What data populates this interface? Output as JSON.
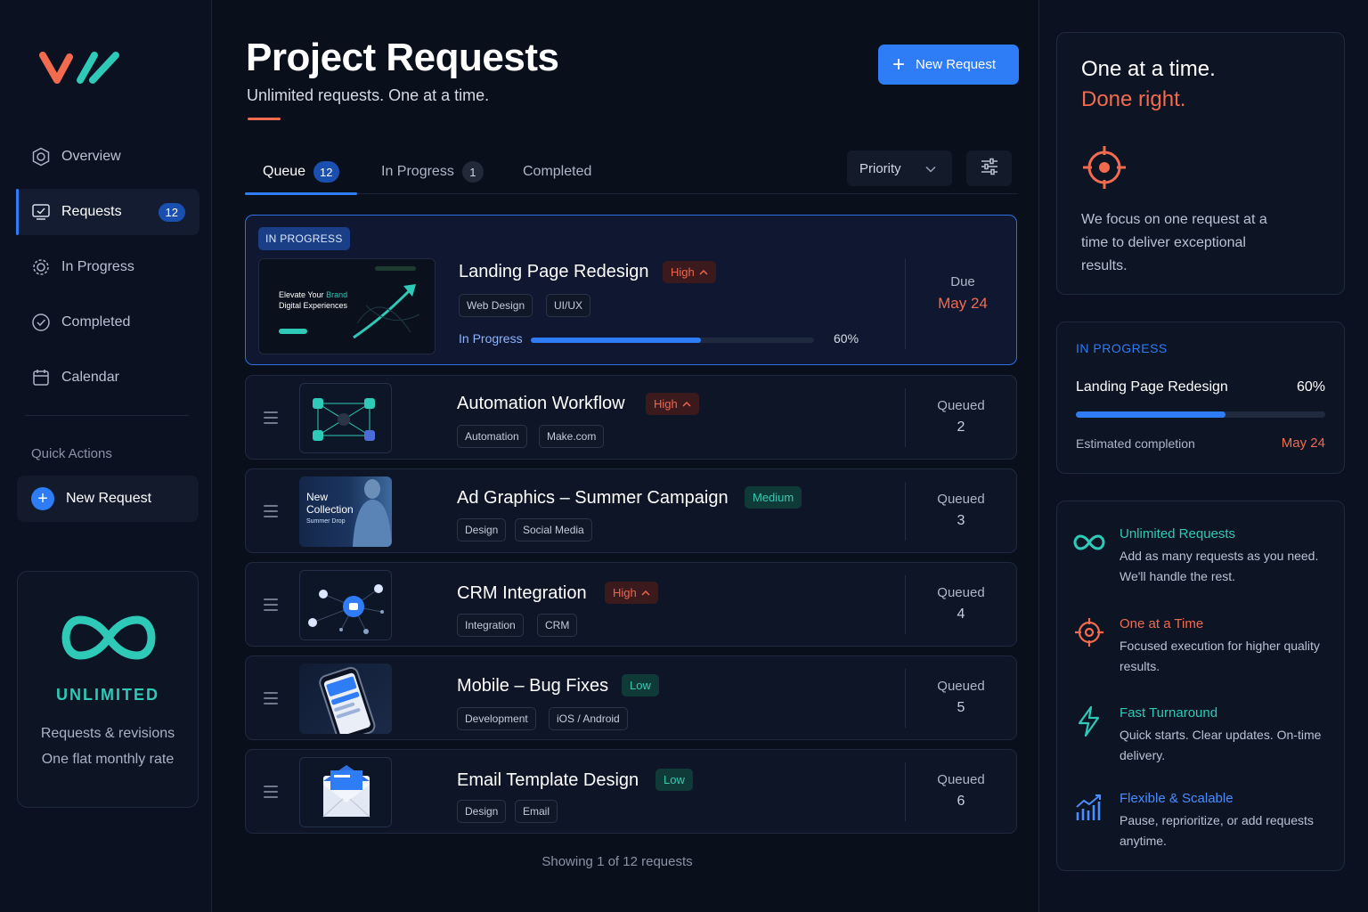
{
  "sidebar": {
    "nav": [
      {
        "label": "Overview",
        "icon": "overview-icon"
      },
      {
        "label": "Requests",
        "icon": "requests-icon",
        "badge": "12"
      },
      {
        "label": "In Progress",
        "icon": "in-progress-icon"
      },
      {
        "label": "Completed",
        "icon": "check-circle-icon"
      },
      {
        "label": "Calendar",
        "icon": "calendar-icon"
      }
    ],
    "quick_actions_label": "Quick Actions",
    "new_request_label": "New Request",
    "unlimited": {
      "title": "UNLIMITED",
      "line1": "Requests & revisions",
      "line2": "One flat monthly rate"
    }
  },
  "header": {
    "title": "Project Requests",
    "subtitle": "Unlimited requests. One at a time.",
    "new_request_label": "New Request"
  },
  "tabs": [
    {
      "label": "Queue",
      "count": "12"
    },
    {
      "label": "In Progress",
      "count": "1"
    },
    {
      "label": "Completed"
    }
  ],
  "sort": {
    "label": "Priority"
  },
  "featured": {
    "badge": "IN PROGRESS",
    "title": "Landing Page Redesign",
    "priority": "High",
    "tags": [
      "Web Design",
      "UI/UX"
    ],
    "progress_label": "In Progress",
    "progress": 0.6,
    "progress_text": "60%",
    "due_label": "Due",
    "due_date": "May 24",
    "thumb_line1": "Elevate Your",
    "thumb_brand": "Brand",
    "thumb_line2": "Digital Experiences"
  },
  "queue": [
    {
      "title": "Automation Workflow",
      "priority": "High",
      "tags": [
        "Automation",
        "Make.com"
      ],
      "status": "Queued",
      "position": "2"
    },
    {
      "title": "Ad Graphics – Summer Campaign",
      "priority": "Medium",
      "tags": [
        "Design",
        "Social Media"
      ],
      "status": "Queued",
      "position": "3",
      "thumb_text1": "New",
      "thumb_text2": "Collection",
      "thumb_text3": "Summer Drop"
    },
    {
      "title": "CRM Integration",
      "priority": "High",
      "tags": [
        "Integration",
        "CRM"
      ],
      "status": "Queued",
      "position": "4"
    },
    {
      "title": "Mobile – Bug Fixes",
      "priority": "Low",
      "tags": [
        "Development",
        "iOS / Android"
      ],
      "status": "Queued",
      "position": "5"
    },
    {
      "title": "Email Template Design",
      "priority": "Low",
      "tags": [
        "Design",
        "Email"
      ],
      "status": "Queued",
      "position": "6"
    }
  ],
  "footer": {
    "showing": "Showing 1 of 12 requests"
  },
  "right": {
    "hero": {
      "line1": "One at a time.",
      "line2": "Done right.",
      "body": "We focus on one request at a time to deliver exceptional results."
    },
    "status": {
      "label": "IN PROGRESS",
      "name": "Landing Page Redesign",
      "pct": "60%",
      "progress": 0.6,
      "est_label": "Estimated completion",
      "est_date": "May 24"
    },
    "features": [
      {
        "title": "Unlimited Requests",
        "desc": "Add as many requests as you need. We'll handle the rest.",
        "color": "#2ec9b7",
        "icon": "infinity-icon"
      },
      {
        "title": "One at a Time",
        "desc": "Focused execution for higher quality results.",
        "color": "#f26b4f",
        "icon": "target-icon"
      },
      {
        "title": "Fast Turnaround",
        "desc": "Quick starts. Clear updates. On-time delivery.",
        "color": "#2ec9b7",
        "icon": "lightning-icon"
      },
      {
        "title": "Flexible & Scalable",
        "desc": "Pause, reprioritize, or add requests anytime.",
        "color": "#4a8dff",
        "icon": "chart-icon"
      }
    ]
  },
  "colors": {
    "accent": "#2f7df6",
    "coral": "#f26b4f",
    "teal": "#2ec9b7",
    "background": "#0a0f1c"
  }
}
